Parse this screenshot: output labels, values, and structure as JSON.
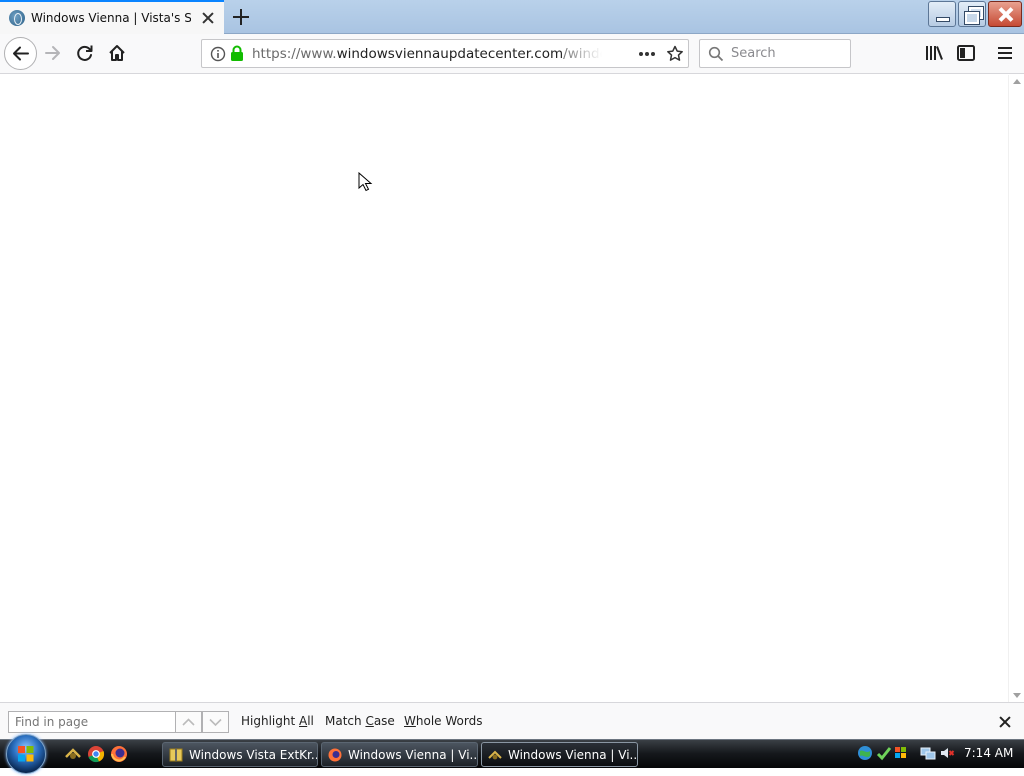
{
  "browser": {
    "tab": {
      "title": "Windows Vienna | Vista's Site",
      "favicon": "wordpress-globe-icon"
    },
    "url": {
      "prefix": "https://www.",
      "domain": "windowsviennaupdatecenter.com",
      "path": "/windows-"
    },
    "search": {
      "placeholder": "Search"
    }
  },
  "findbar": {
    "placeholder": "Find in page",
    "highlight_all": {
      "pre": "Highlight ",
      "key": "A",
      "post": "ll"
    },
    "match_case": {
      "pre": "Match ",
      "key": "C",
      "post": "ase"
    },
    "whole_words": {
      "pre": "",
      "key": "W",
      "post": "hole Words"
    }
  },
  "taskbar": {
    "buttons": [
      {
        "label": "Windows Vista ExtKr...",
        "icon": "folder-zip-icon"
      },
      {
        "label": "Windows Vienna | Vi...",
        "icon": "firefox-icon"
      },
      {
        "label": "Windows Vienna | Vi...",
        "icon": "vienna-app-icon"
      }
    ],
    "clock": "7:14 AM"
  },
  "colors": {
    "tab_accent": "#0a84ff",
    "secure_lock": "#12bc00"
  }
}
